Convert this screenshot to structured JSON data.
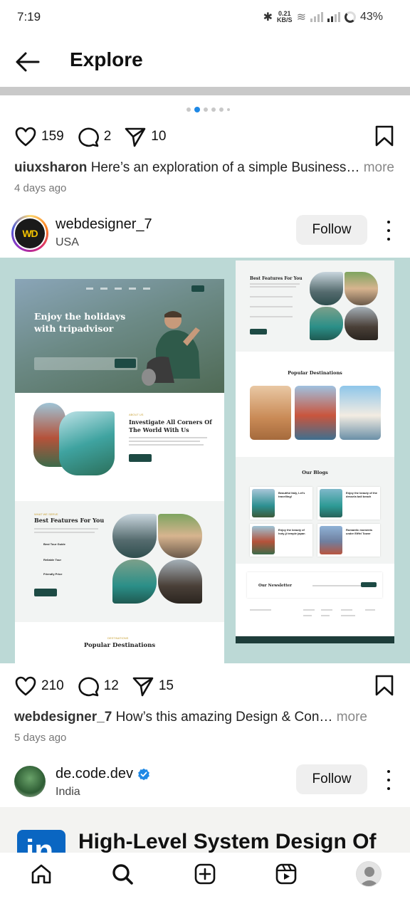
{
  "status": {
    "time": "7:19",
    "net_speed": "0.21",
    "net_unit": "KB/S",
    "battery": "43%"
  },
  "header": {
    "title": "Explore"
  },
  "post1": {
    "likes": "159",
    "comments": "2",
    "shares": "10",
    "caption_user": "uiuxsharon",
    "caption_text": "Here’s an exploration of a simple Business…",
    "more": "more",
    "time_ago": "4 days ago"
  },
  "post2": {
    "username": "webdesigner_7",
    "location": "USA",
    "follow_label": "Follow",
    "avatar_text": "WD",
    "mockup": {
      "hero_title": "Enjoy the holidays with tripadvisor",
      "sec2_title": "Investigate All Corners Of The World With Us",
      "sec3_title": "Best Features For You",
      "sec4_title": "Popular Destinations",
      "r_best_features": "Best Features For You",
      "r_popular": "Popular Destinations",
      "r_blogs": "Our Blogs",
      "r_newsletter": "Our Newsletter",
      "blog1": "Beautiful Italy, Let's travelling!",
      "blog2": "Enjoy the beauty of the dessela bali beach",
      "blog3": "Enjoy the beauty of hoty-ji temple japan",
      "blog4": "Romantic moments under Eiffel Tower",
      "features": [
        "Best Tour Guide",
        "Reliable Tour",
        "Friendly Price"
      ]
    },
    "likes": "210",
    "comments": "12",
    "shares": "15",
    "caption_user": "webdesigner_7",
    "caption_text": "How’s this amazing Design & Con…",
    "more": "more",
    "time_ago": "5 days ago"
  },
  "post3": {
    "username": "de.code.dev",
    "location": "India",
    "follow_label": "Follow",
    "title_preview": "High-Level System Design Of",
    "logo_text": "in"
  },
  "colors": {
    "accent": "#1e88e5",
    "image_bg": "#bcd9d6",
    "brand_dark": "#1d4a44",
    "follow_bg": "#efefef"
  },
  "nav": {
    "items": [
      "home-icon",
      "search-icon",
      "create-icon",
      "reels-icon",
      "profile-avatar"
    ]
  }
}
